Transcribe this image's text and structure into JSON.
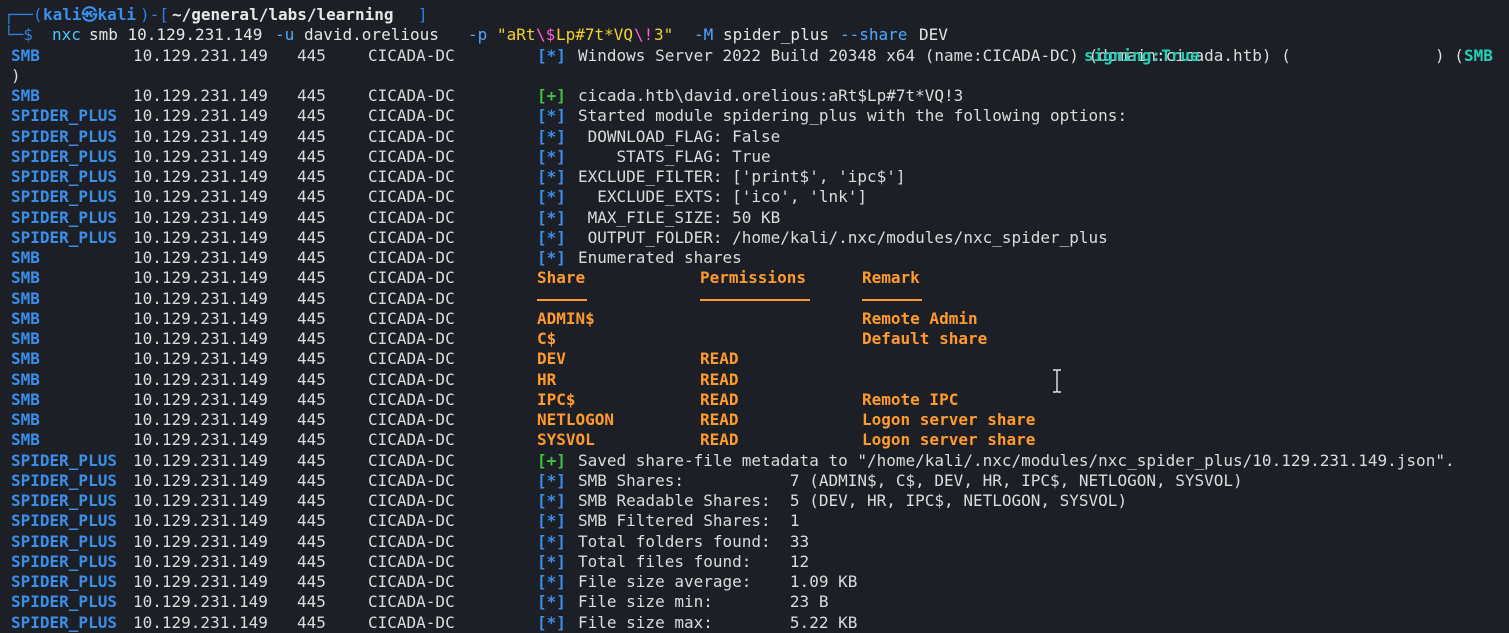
{
  "prompt": {
    "frame_top": "┌──(",
    "user": "kali㉿kali",
    "mid": ")-[",
    "path": "~/general/labs/learning",
    "end": "]",
    "frame_bottom": "└─$",
    "cmd_bin": "nxc",
    "cmd_1": "smb 10.129.231.149",
    "flag_u": "-u",
    "user_arg": "david.orelious",
    "flag_p": "-p",
    "pass_a": "\"aRt",
    "pass_esc1": "\\$",
    "pass_b": "Lp#7t*VQ",
    "pass_esc2": "\\!",
    "pass_c": "3\"",
    "flag_m": "-M",
    "module": "spider_plus",
    "flag_share": "--share",
    "share_arg": "DEV"
  },
  "host": {
    "ip": "10.129.231.149",
    "port": "445",
    "name": "CICADA-DC"
  },
  "info_line": {
    "text": "Windows Server 2022 Build 20348 x64 (name:CICADA-DC) (domain:cicada.htb) (",
    "signing": "signing:True",
    "after": ") (",
    "tail": "SMB",
    "wrap": ")"
  },
  "share_table": {
    "headers": [
      "Share",
      "Permissions",
      "Remark"
    ],
    "rows": [
      {
        "share": "ADMIN$",
        "perm": "",
        "remark": "Remote Admin"
      },
      {
        "share": "C$",
        "perm": "",
        "remark": "Default share"
      },
      {
        "share": "DEV",
        "perm": "READ",
        "remark": ""
      },
      {
        "share": "HR",
        "perm": "READ",
        "remark": ""
      },
      {
        "share": "IPC$",
        "perm": "READ",
        "remark": "Remote IPC"
      },
      {
        "share": "NETLOGON",
        "perm": "READ",
        "remark": "Logon server share"
      },
      {
        "share": "SYSVOL",
        "perm": "READ",
        "remark": "Logon server share"
      }
    ]
  },
  "lines": [
    {
      "proto": "SMB",
      "kind": "info"
    },
    {
      "proto": "",
      "kind": "wrap"
    },
    {
      "proto": "SMB",
      "kind": "msg",
      "bracket": "[+]",
      "text": "cicada.htb\\david.orelious:aRt$Lp#7t*VQ!3"
    },
    {
      "proto": "SPIDER_PLUS",
      "kind": "msg",
      "bracket": "[*]",
      "text": "Started module spidering_plus with the following options:"
    },
    {
      "proto": "SPIDER_PLUS",
      "kind": "msg",
      "bracket": "[*]",
      "text": " DOWNLOAD_FLAG: False"
    },
    {
      "proto": "SPIDER_PLUS",
      "kind": "msg",
      "bracket": "[*]",
      "text": "    STATS_FLAG: True"
    },
    {
      "proto": "SPIDER_PLUS",
      "kind": "msg",
      "bracket": "[*]",
      "text": "EXCLUDE_FILTER: ['print$', 'ipc$']"
    },
    {
      "proto": "SPIDER_PLUS",
      "kind": "msg",
      "bracket": "[*]",
      "text": "  EXCLUDE_EXTS: ['ico', 'lnk']"
    },
    {
      "proto": "SPIDER_PLUS",
      "kind": "msg",
      "bracket": "[*]",
      "text": " MAX_FILE_SIZE: 50 KB"
    },
    {
      "proto": "SPIDER_PLUS",
      "kind": "msg",
      "bracket": "[*]",
      "text": " OUTPUT_FOLDER: /home/kali/.nxc/modules/nxc_spider_plus"
    },
    {
      "proto": "SMB",
      "kind": "msg",
      "bracket": "[*]",
      "text": "Enumerated shares"
    },
    {
      "proto": "SMB",
      "kind": "share_hdr"
    },
    {
      "proto": "SMB",
      "kind": "share_ul"
    },
    {
      "proto": "SMB",
      "kind": "share_row",
      "row": 0
    },
    {
      "proto": "SMB",
      "kind": "share_row",
      "row": 1
    },
    {
      "proto": "SMB",
      "kind": "share_row",
      "row": 2
    },
    {
      "proto": "SMB",
      "kind": "share_row",
      "row": 3
    },
    {
      "proto": "SMB",
      "kind": "share_row",
      "row": 4
    },
    {
      "proto": "SMB",
      "kind": "share_row",
      "row": 5
    },
    {
      "proto": "SMB",
      "kind": "share_row",
      "row": 6
    },
    {
      "proto": "SPIDER_PLUS",
      "kind": "msg",
      "bracket": "[+]",
      "text": "Saved share-file metadata to \"/home/kali/.nxc/modules/nxc_spider_plus/10.129.231.149.json\"."
    },
    {
      "proto": "SPIDER_PLUS",
      "kind": "msg",
      "bracket": "[*]",
      "text": "SMB Shares:           7 (ADMIN$, C$, DEV, HR, IPC$, NETLOGON, SYSVOL)"
    },
    {
      "proto": "SPIDER_PLUS",
      "kind": "msg",
      "bracket": "[*]",
      "text": "SMB Readable Shares:  5 (DEV, HR, IPC$, NETLOGON, SYSVOL)"
    },
    {
      "proto": "SPIDER_PLUS",
      "kind": "msg",
      "bracket": "[*]",
      "text": "SMB Filtered Shares:  1"
    },
    {
      "proto": "SPIDER_PLUS",
      "kind": "msg",
      "bracket": "[*]",
      "text": "Total folders found:  33"
    },
    {
      "proto": "SPIDER_PLUS",
      "kind": "msg",
      "bracket": "[*]",
      "text": "Total files found:    12"
    },
    {
      "proto": "SPIDER_PLUS",
      "kind": "msg",
      "bracket": "[*]",
      "text": "File size average:    1.09 KB"
    },
    {
      "proto": "SPIDER_PLUS",
      "kind": "msg",
      "bracket": "[*]",
      "text": "File size min:        23 B"
    },
    {
      "proto": "SPIDER_PLUS",
      "kind": "msg",
      "bracket": "[*]",
      "text": "File size max:        5.22 KB"
    }
  ],
  "colors": {
    "background": "#1c1f26",
    "prompt_blue": "#3b8eea",
    "share_orange": "#ff9a2e",
    "success_green": "#3ec43e",
    "string_yellow": "#f2d32e",
    "signing_teal": "#23d1b6"
  },
  "icons": {
    "cursor": "text-cursor-ibeam-icon"
  }
}
